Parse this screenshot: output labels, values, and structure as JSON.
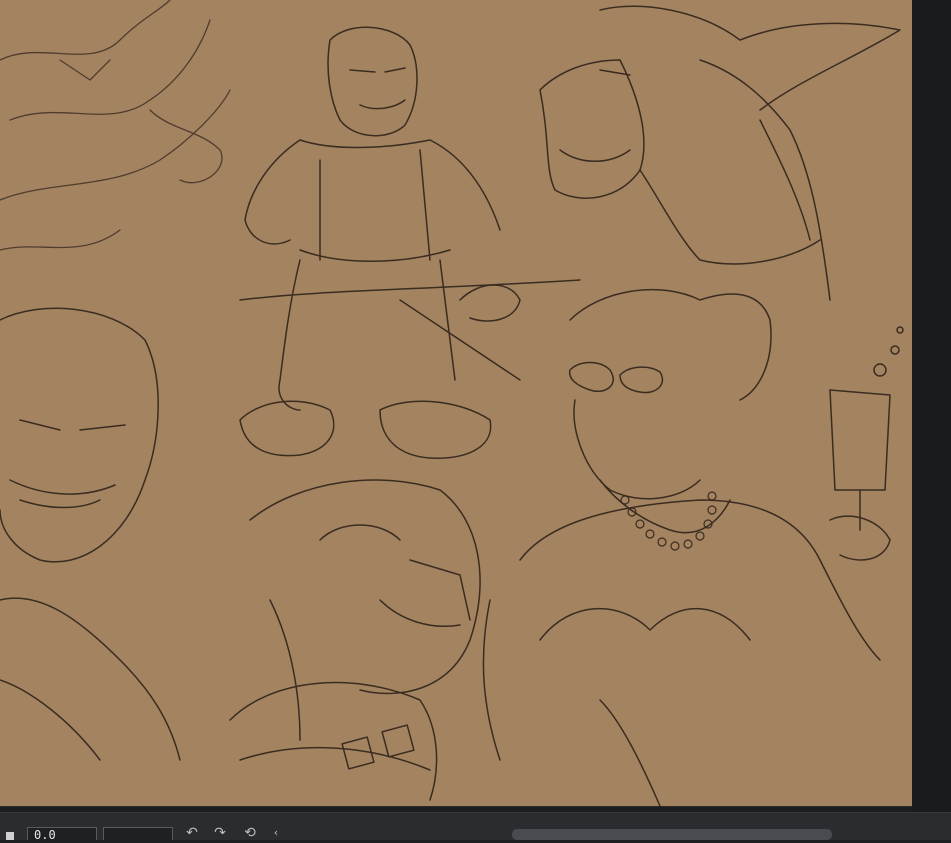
{
  "app": {
    "zoom_value": "0.0"
  },
  "canvas": {
    "paper_color": "#a48361",
    "ink_color": "#3a2c20",
    "background": "#1c1d1f"
  },
  "toolbar": {
    "icons": [
      "stop-icon",
      "rotate-left-icon",
      "rotate-right-icon",
      "reset-rotation-icon",
      "chevron-left-icon"
    ]
  }
}
